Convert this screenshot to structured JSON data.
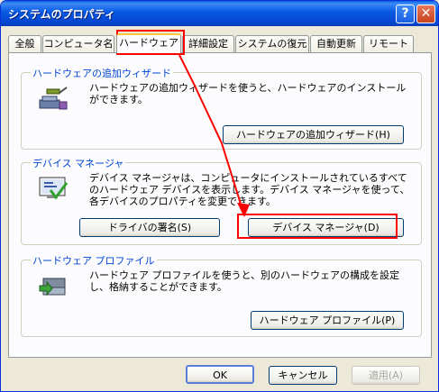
{
  "window": {
    "title": "システムのプロパティ"
  },
  "titlebar_buttons": {
    "help": "?",
    "close": "✕"
  },
  "tabs": [
    {
      "label": "全般"
    },
    {
      "label": "コンピュータ名"
    },
    {
      "label": "ハードウェア"
    },
    {
      "label": "詳細設定"
    },
    {
      "label": "システムの復元"
    },
    {
      "label": "自動更新"
    },
    {
      "label": "リモート"
    }
  ],
  "groups": {
    "add_hw": {
      "title": "ハードウェアの追加ウィザード",
      "desc": "ハードウェアの追加ウィザードを使うと、ハードウェアのインストールができます。",
      "button": "ハードウェアの追加ウィザード(H)",
      "icon": "hardware-wizard-icon"
    },
    "device_manager": {
      "title": "デバイス マネージャ",
      "desc": "デバイス マネージャは、コンピュータにインストールされているすべてのハードウェア デバイスを表示します。デバイス マネージャを使って、各デバイスのプロパティを変更できます。",
      "button_sign": "ドライバの署名(S)",
      "button_dm": "デバイス マネージャ(D)",
      "icon": "device-manager-icon"
    },
    "profiles": {
      "title": "ハードウェア プロファイル",
      "desc": "ハードウェア プロファイルを使うと、別のハードウェアの構成を設定し、格納することができます。",
      "button": "ハードウェア プロファイル(P)",
      "icon": "hardware-profile-icon"
    }
  },
  "footer": {
    "ok": "OK",
    "cancel": "キャンセル",
    "apply": "適用(A)"
  },
  "colors": {
    "highlight": "#ff0000",
    "titlebar": "#0658e3",
    "group_title": "#0046d5"
  }
}
